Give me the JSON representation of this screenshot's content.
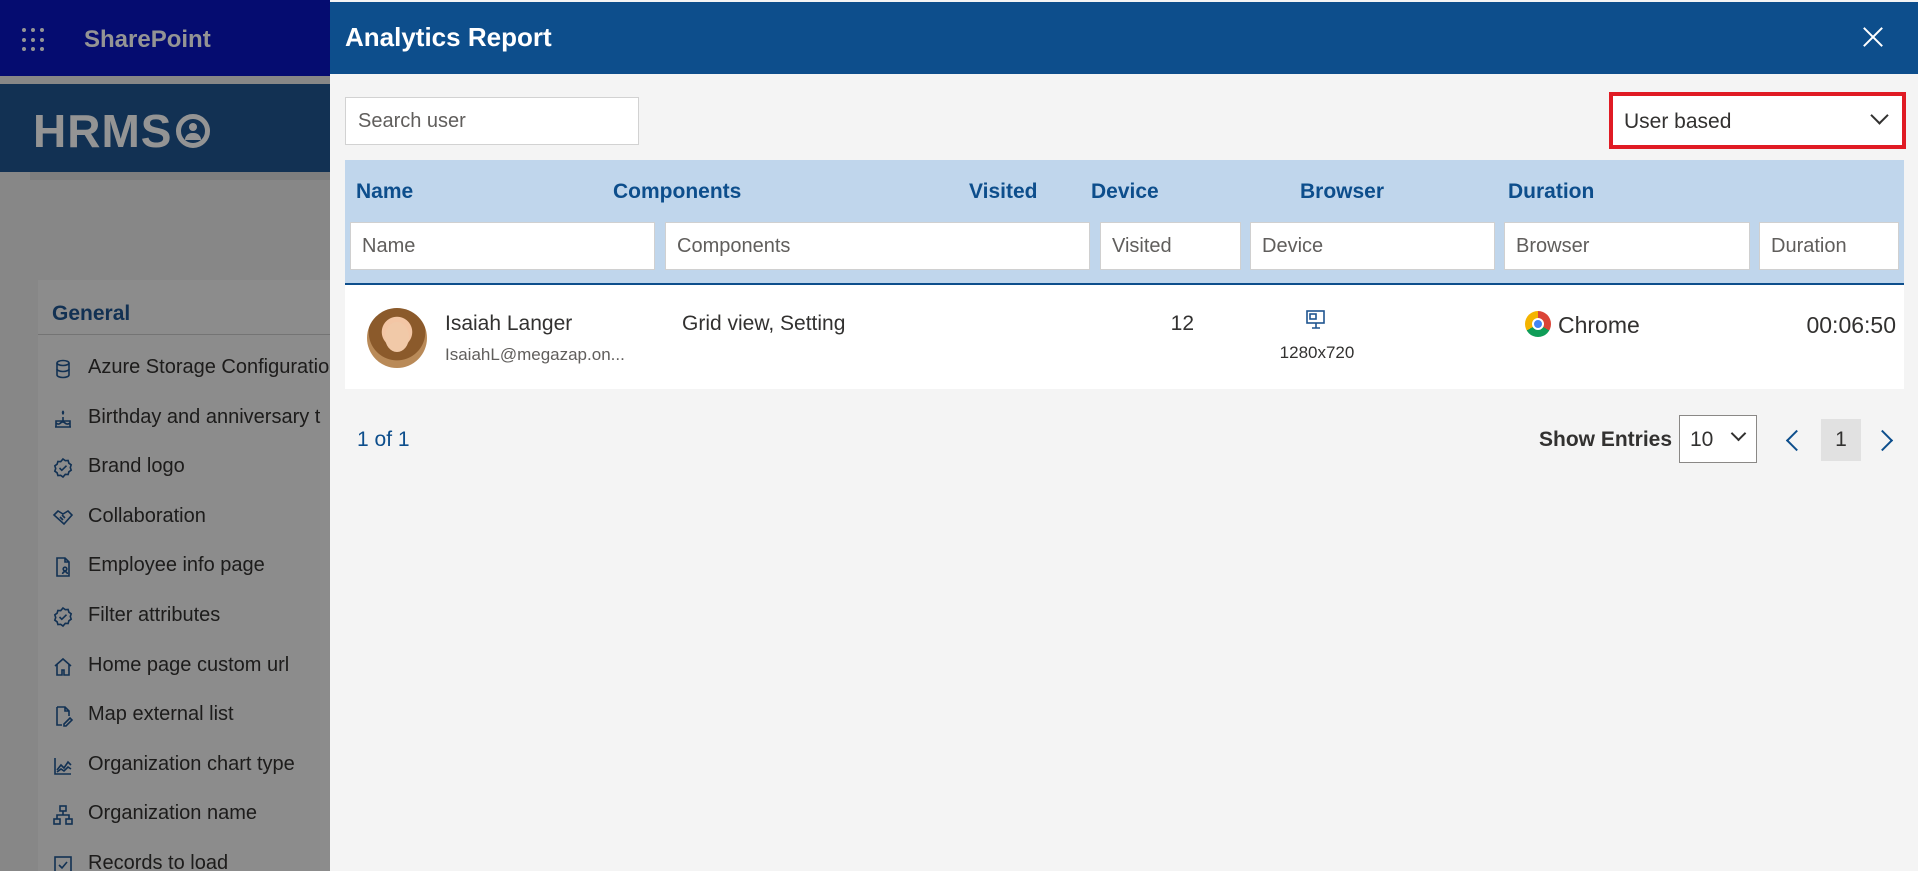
{
  "suite_bar": {
    "app_name": "SharePoint"
  },
  "site": {
    "logo_text": "HRMS"
  },
  "settings": {
    "section_title": "General",
    "items": [
      {
        "label": "Azure Storage Configuration",
        "icon": "database-icon"
      },
      {
        "label": "Birthday and anniversary t",
        "icon": "cake-icon"
      },
      {
        "label": "Brand logo",
        "icon": "badge-icon"
      },
      {
        "label": "Collaboration",
        "icon": "handshake-icon"
      },
      {
        "label": "Employee info page",
        "icon": "document-person-icon"
      },
      {
        "label": "Filter attributes",
        "icon": "badge-icon"
      },
      {
        "label": "Home page custom url",
        "icon": "home-icon"
      },
      {
        "label": "Map external list",
        "icon": "document-edit-icon"
      },
      {
        "label": "Organization chart type",
        "icon": "chart-icon"
      },
      {
        "label": "Organization name",
        "icon": "org-icon"
      },
      {
        "label": "Records to load",
        "icon": "checkbox-icon"
      }
    ]
  },
  "panel": {
    "title": "Analytics Report",
    "search_placeholder": "Search user",
    "view_mode": "User based",
    "columns": [
      {
        "label": "Name",
        "filter_placeholder": "Name"
      },
      {
        "label": "Components",
        "filter_placeholder": "Components"
      },
      {
        "label": "Visited",
        "filter_placeholder": "Visited"
      },
      {
        "label": "Device",
        "filter_placeholder": "Device"
      },
      {
        "label": "Browser",
        "filter_placeholder": "Browser"
      },
      {
        "label": "Duration",
        "filter_placeholder": "Duration"
      }
    ],
    "rows": [
      {
        "name": "Isaiah Langer",
        "email": "IsaiahL@megazap.on...",
        "components": "Grid view, Setting",
        "visited": "12",
        "device_icon": "monitor-icon",
        "resolution": "1280x720",
        "browser": "Chrome",
        "browser_icon": "chrome-icon",
        "duration": "00:06:50"
      }
    ],
    "pagination": {
      "page_count_text": "1 of 1",
      "show_entries_label": "Show Entries",
      "entries_value": "10",
      "current_page": "1"
    }
  },
  "colors": {
    "suite_bar": "#0a15c2",
    "panel_header": "#0d4e8c",
    "table_header": "#c0d6ec",
    "highlight_border": "#e01b24"
  }
}
